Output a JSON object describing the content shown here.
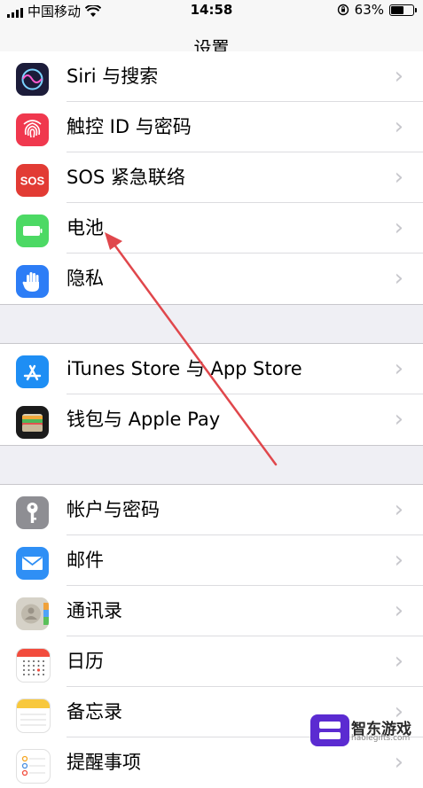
{
  "status_bar": {
    "carrier": "中国移动",
    "time": "14:58",
    "battery_percent": "63%",
    "battery_level": 0.63
  },
  "nav": {
    "title": "设置"
  },
  "groups": [
    [
      {
        "name": "siri",
        "label": "Siri 与搜索",
        "icon": "siri-icon",
        "color": "#1c1c3a"
      },
      {
        "name": "touch-id",
        "label": "触控 ID 与密码",
        "icon": "fingerprint-icon",
        "color": "#f0384e"
      },
      {
        "name": "sos",
        "label": "SOS 紧急联络",
        "icon": "sos-icon",
        "color": "#e23b34"
      },
      {
        "name": "battery",
        "label": "电池",
        "icon": "battery-icon",
        "color": "#4cd964"
      },
      {
        "name": "privacy",
        "label": "隐私",
        "icon": "hand-icon",
        "color": "#2d7df6"
      }
    ],
    [
      {
        "name": "app-store",
        "label": "iTunes Store 与 App Store",
        "icon": "app-store-icon",
        "color": "#1e8ef4"
      },
      {
        "name": "wallet",
        "label": "钱包与 Apple Pay",
        "icon": "wallet-icon",
        "color": "#1b1b1b"
      }
    ],
    [
      {
        "name": "accounts",
        "label": "帐户与密码",
        "icon": "key-icon",
        "color": "#8e8e93"
      },
      {
        "name": "mail",
        "label": "邮件",
        "icon": "mail-icon",
        "color": "#2f8ff5"
      },
      {
        "name": "contacts",
        "label": "通讯录",
        "icon": "contacts-icon",
        "color": "#d6d2c8"
      },
      {
        "name": "calendar",
        "label": "日历",
        "icon": "calendar-icon",
        "color": "#ffffff"
      },
      {
        "name": "notes",
        "label": "备忘录",
        "icon": "notes-icon",
        "color": "#ffffff"
      },
      {
        "name": "reminders",
        "label": "提醒事项",
        "icon": "reminders-icon",
        "color": "#ffffff"
      }
    ]
  ],
  "chevron": "›",
  "watermark": {
    "text": "智东游戏",
    "url": "haolegifts.com"
  },
  "accent_arrow_color": "#e0474c"
}
